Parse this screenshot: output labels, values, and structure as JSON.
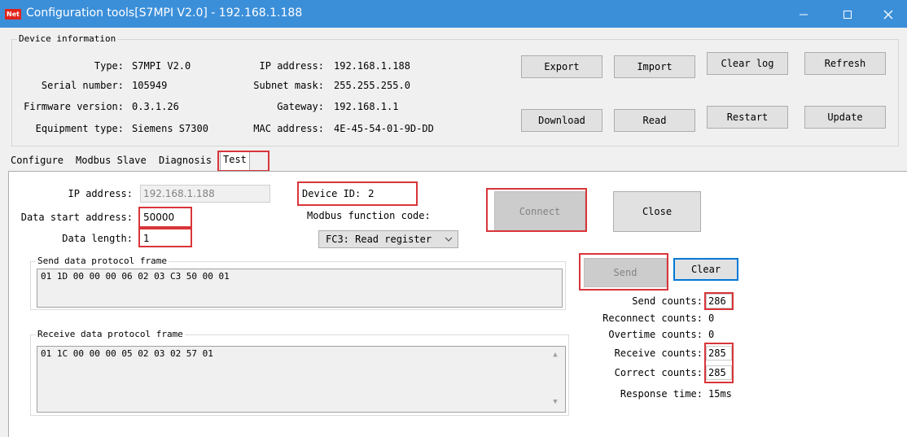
{
  "window": {
    "app_icon": "Net",
    "title": "Configuration tools[S7MPI V2.0] - 192.168.1.188"
  },
  "device_info": {
    "legend": "Device information",
    "type_label": "Type:",
    "type_value": "S7MPI V2.0",
    "serial_label": "Serial number:",
    "serial_value": "105949",
    "firmware_label": "Firmware version:",
    "firmware_value": "0.3.1.26",
    "equipment_label": "Equipment type:",
    "equipment_value": "Siemens S7300",
    "ip_label": "IP address:",
    "ip_value": "192.168.1.188",
    "subnet_label": "Subnet mask:",
    "subnet_value": "255.255.255.0",
    "gateway_label": "Gateway:",
    "gateway_value": "192.168.1.1",
    "mac_label": "MAC address:",
    "mac_value": "4E-45-54-01-9D-DD"
  },
  "toolbar": {
    "export": "Export",
    "import": "Import",
    "clear_log": "Clear log",
    "refresh": "Refresh",
    "download": "Download",
    "read": "Read",
    "restart": "Restart",
    "update": "Update"
  },
  "tabs": [
    "Configure",
    "Modbus Slave",
    "Diagnosis",
    "Test"
  ],
  "test": {
    "ip_label": "IP address:",
    "ip_value": "192.168.1.188",
    "start_label": "Data start address:",
    "start_value": "50000",
    "length_label": "Data length:",
    "length_value": "1",
    "device_id_label": "Device ID:",
    "device_id_value": "2",
    "function_label": "Modbus function code:",
    "function_value": "FC3: Read register",
    "connect": "Connect",
    "close": "Close",
    "send_legend": "Send data protocol frame",
    "send_frame": "01 1D 00 00 00 06 02 03 C3 50 00 01",
    "receive_legend": "Receive data protocol frame",
    "receive_frame": "01 1C 00 00 00 05 02 03 02 57 01",
    "send": "Send",
    "clear": "Clear",
    "send_counts_label": "Send counts:",
    "send_counts": "286",
    "reconnect_label": "Reconnect counts:",
    "reconnect_counts": "0",
    "overtime_label": "Overtime counts:",
    "overtime_counts": "0",
    "receive_counts_label": "Receive counts:",
    "receive_counts": "285",
    "correct_counts_label": "Correct counts:",
    "correct_counts": "285",
    "response_label": "Response time:",
    "response_time": "15ms"
  },
  "colors": {
    "titlebar": "#3b8fd9",
    "highlight": "#d9353a",
    "focus": "#2f78c4"
  }
}
